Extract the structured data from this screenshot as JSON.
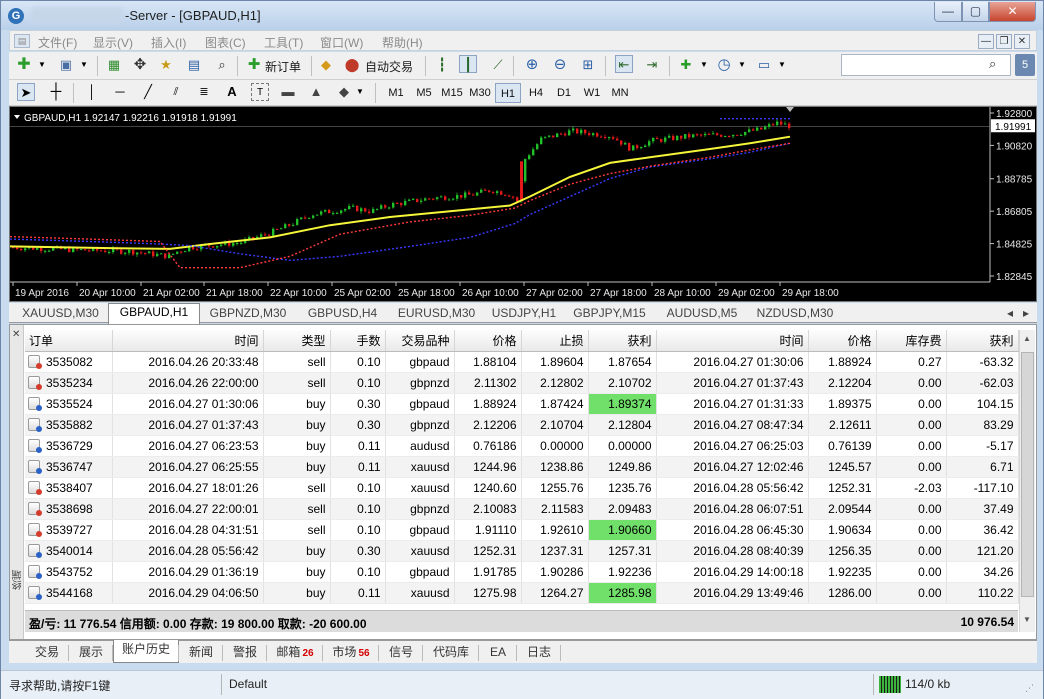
{
  "window": {
    "title_suffix": "-Server - [GBPAUD,H1]",
    "min": "—",
    "max": "▢",
    "close": "✕"
  },
  "menu": [
    "文件(F)",
    "显示(V)",
    "插入(I)",
    "图表(C)",
    "工具(T)",
    "窗口(W)",
    "帮助(H)"
  ],
  "toolbar": {
    "new_order": "新订单",
    "auto_trading": "自动交易",
    "timeframes": [
      "M1",
      "M5",
      "M15",
      "M30",
      "H1",
      "H4",
      "D1",
      "W1",
      "MN"
    ],
    "active_timeframe": "H1",
    "search_placeholder": ""
  },
  "chart": {
    "symbol_header": "GBPAUD,H1  1.92147 1.92216 1.91918 1.91991",
    "current_price": "1.91991",
    "price_labels": [
      "1.92800",
      "1.90820",
      "1.88785",
      "1.86805",
      "1.84825",
      "1.82845"
    ],
    "time_labels": [
      "19 Apr 2016",
      "20 Apr 10:00",
      "21 Apr 02:00",
      "21 Apr 18:00",
      "22 Apr 10:00",
      "25 Apr 02:00",
      "25 Apr 18:00",
      "26 Apr 10:00",
      "27 Apr 02:00",
      "27 Apr 18:00",
      "28 Apr 10:00",
      "29 Apr 02:00",
      "29 Apr 18:00"
    ]
  },
  "chart_tabs": [
    "XAUUSD,M30",
    "GBPAUD,H1",
    "GBPNZD,M30",
    "GBPUSD,H4",
    "EURUSD,M30",
    "USDJPY,H1",
    "GBPJPY,M15",
    "AUDUSD,M5",
    "NZDUSD,M30"
  ],
  "active_chart_tab": "GBPAUD,H1",
  "history": {
    "headers": [
      "订单",
      "时间",
      "类型",
      "手数",
      "交易品种",
      "价格",
      "止损",
      "获利",
      "时间",
      "价格",
      "库存费",
      "获利"
    ],
    "rows": [
      [
        "3535082",
        "2016.04.26 20:33:48",
        "sell",
        "0.10",
        "gbpaud",
        "1.88104",
        "1.89604",
        "1.87654",
        "2016.04.27 01:30:06",
        "1.88924",
        "0.27",
        "-63.32"
      ],
      [
        "3535234",
        "2016.04.26 22:00:00",
        "sell",
        "0.10",
        "gbpnzd",
        "2.11302",
        "2.12802",
        "2.10702",
        "2016.04.27 01:37:43",
        "2.12204",
        "0.00",
        "-62.03"
      ],
      [
        "3535524",
        "2016.04.27 01:30:06",
        "buy",
        "0.30",
        "gbpaud",
        "1.88924",
        "1.87424",
        "1.89374",
        "2016.04.27 01:31:33",
        "1.89375",
        "0.00",
        "104.15"
      ],
      [
        "3535882",
        "2016.04.27 01:37:43",
        "buy",
        "0.30",
        "gbpnzd",
        "2.12206",
        "2.10704",
        "2.12804",
        "2016.04.27 08:47:34",
        "2.12611",
        "0.00",
        "83.29"
      ],
      [
        "3536729",
        "2016.04.27 06:23:53",
        "buy",
        "0.11",
        "audusd",
        "0.76186",
        "0.00000",
        "0.00000",
        "2016.04.27 06:25:03",
        "0.76139",
        "0.00",
        "-5.17"
      ],
      [
        "3536747",
        "2016.04.27 06:25:55",
        "buy",
        "0.11",
        "xauusd",
        "1244.96",
        "1238.86",
        "1249.86",
        "2016.04.27 12:02:46",
        "1245.57",
        "0.00",
        "6.71"
      ],
      [
        "3538407",
        "2016.04.27 18:01:26",
        "sell",
        "0.10",
        "xauusd",
        "1240.60",
        "1255.76",
        "1235.76",
        "2016.04.28 05:56:42",
        "1252.31",
        "-2.03",
        "-117.10"
      ],
      [
        "3538698",
        "2016.04.27 22:00:01",
        "sell",
        "0.10",
        "gbpnzd",
        "2.10083",
        "2.11583",
        "2.09483",
        "2016.04.28 06:07:51",
        "2.09544",
        "0.00",
        "37.49"
      ],
      [
        "3539727",
        "2016.04.28 04:31:51",
        "sell",
        "0.10",
        "gbpaud",
        "1.91110",
        "1.92610",
        "1.90660",
        "2016.04.28 06:45:30",
        "1.90634",
        "0.00",
        "36.42"
      ],
      [
        "3540014",
        "2016.04.28 05:56:42",
        "buy",
        "0.30",
        "xauusd",
        "1252.31",
        "1237.31",
        "1257.31",
        "2016.04.28 08:40:39",
        "1256.35",
        "0.00",
        "121.20"
      ],
      [
        "3543752",
        "2016.04.29 01:36:19",
        "buy",
        "0.10",
        "gbpaud",
        "1.91785",
        "1.90286",
        "1.92236",
        "2016.04.29 14:00:18",
        "1.92235",
        "0.00",
        "34.26"
      ],
      [
        "3544168",
        "2016.04.29 04:06:50",
        "buy",
        "0.11",
        "xauusd",
        "1275.98",
        "1264.27",
        "1285.98",
        "2016.04.29 13:49:46",
        "1286.00",
        "0.00",
        "110.22"
      ]
    ],
    "highlight_rows": [
      2,
      8,
      11
    ],
    "summary": "盈/亏: 11 776.54  信用额: 0.00  存款: 19 800.00  取款: -20 600.00",
    "summary_total": "10 976.54"
  },
  "bottom_tabs": [
    {
      "label": "交易",
      "badge": ""
    },
    {
      "label": "展示",
      "badge": ""
    },
    {
      "label": "账户历史",
      "badge": ""
    },
    {
      "label": "新闻",
      "badge": ""
    },
    {
      "label": "警报",
      "badge": ""
    },
    {
      "label": "邮箱",
      "badge": "26"
    },
    {
      "label": "市场",
      "badge": "56"
    },
    {
      "label": "信号",
      "badge": ""
    },
    {
      "label": "代码库",
      "badge": ""
    },
    {
      "label": "EA",
      "badge": ""
    },
    {
      "label": "日志",
      "badge": ""
    }
  ],
  "active_bottom_tab": "账户历史",
  "side_label": "终端",
  "status": {
    "help": "寻求帮助,请按F1键",
    "profile": "Default",
    "traffic": "114/0 kb"
  },
  "colors": {
    "bull": "#21c229",
    "bear": "#e41a1a",
    "ma_yellow": "#f5f53a",
    "ma_blue": "#3a3aff",
    "ma_red": "#ff3a3a",
    "highlight": "#71e06a"
  }
}
